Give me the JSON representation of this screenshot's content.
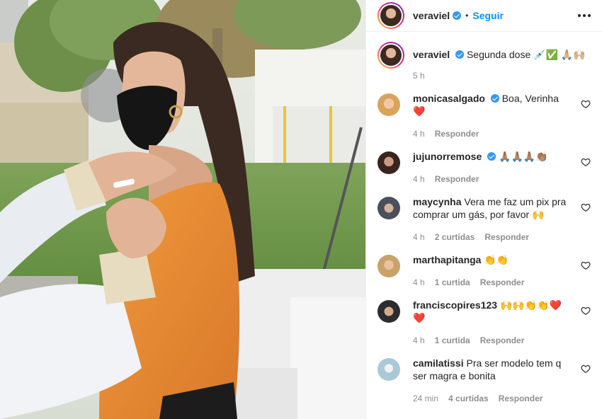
{
  "post": {
    "username": "veraviel",
    "follow_label": "Seguir",
    "separator": "•"
  },
  "caption": {
    "username": "veraviel",
    "text": "Segunda dose 💉✅ 🙏🏼🙌🏼",
    "time": "5 h"
  },
  "reply_label": "Responder",
  "comments": [
    {
      "username": "monicasalgado",
      "verified": true,
      "text": "Boa, Verinha❤️",
      "time": "4 h",
      "likes": ""
    },
    {
      "username": "jujunorremose",
      "verified": true,
      "text": "🙏🏽🙏🏽🙏🏽👏🏽",
      "time": "4 h",
      "likes": ""
    },
    {
      "username": "maycynha",
      "verified": false,
      "text": "Vera me faz um pix pra comprar um gás, por favor 🙌",
      "time": "4 h",
      "likes": "2 curtidas"
    },
    {
      "username": "marthapitanga",
      "verified": false,
      "text": "👏👏",
      "time": "4 h",
      "likes": "1 curtida"
    },
    {
      "username": "franciscopires123",
      "verified": false,
      "text": "🙌🙌👏👏❤️❤️",
      "time": "4 h",
      "likes": "1 curtida"
    },
    {
      "username": "camilatissi",
      "verified": false,
      "text": "Pra ser modelo tem q ser magra e bonita",
      "time": "24 min",
      "likes": "4 curtidas"
    }
  ],
  "colors": {
    "accent": "#0095f6",
    "verified": "#3897f0",
    "muted": "#8e8e8e",
    "sweater": "#e8892f"
  },
  "icons": [
    "verified-badge-icon",
    "more-options-icon",
    "heart-icon"
  ]
}
